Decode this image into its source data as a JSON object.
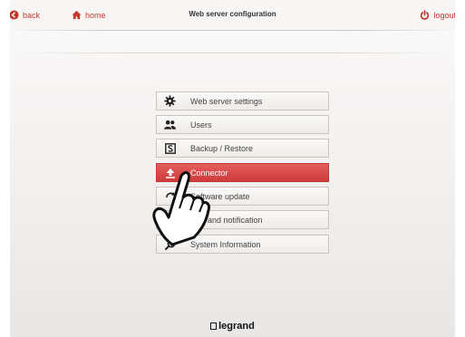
{
  "header": {
    "title": "Web server configuration",
    "back_label": "back",
    "home_label": "home",
    "logout_label": "logout"
  },
  "menu": {
    "items": [
      {
        "label": "Web server settings",
        "icon": "gear-icon"
      },
      {
        "label": "Users",
        "icon": "users-icon"
      },
      {
        "label": "Backup / Restore",
        "icon": "backup-icon"
      },
      {
        "label": "Connector",
        "icon": "upload-icon",
        "active": true
      },
      {
        "label": "Software update",
        "icon": "update-icon"
      },
      {
        "label": "Mail and notification",
        "icon": "mail-icon"
      },
      {
        "label": "System Information",
        "icon": "search-icon"
      }
    ]
  },
  "footer": {
    "brand": "legrand"
  },
  "colors": {
    "accent": "#c0392b",
    "active": "#d94848"
  }
}
